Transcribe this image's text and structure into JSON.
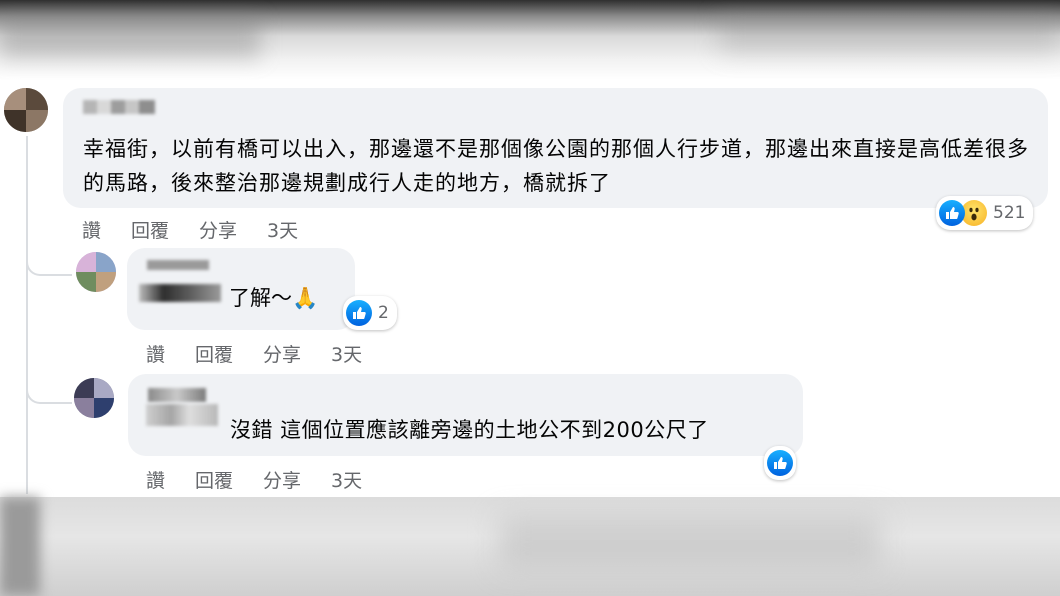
{
  "comments": {
    "main": {
      "text": "幸福街，以前有橋可以出入，那邊還不是那個像公園的那個人行步道，那邊出來直接是高低差很多的馬路，後來整治那邊規劃成行人走的地方，橋就拆了",
      "reaction_count": "521",
      "reaction_icons": [
        "like-icon",
        "wow-icon"
      ],
      "actions": {
        "like": "讚",
        "reply": "回覆",
        "share": "分享",
        "time": "3天"
      }
    },
    "reply1": {
      "text": "了解～🙏",
      "reaction_count": "2",
      "reaction_icons": [
        "like-icon"
      ],
      "actions": {
        "like": "讚",
        "reply": "回覆",
        "share": "分享",
        "time": "3天"
      }
    },
    "reply2": {
      "text": "沒錯 這個位置應該離旁邊的土地公不到200公尺了",
      "reaction_icons": [
        "like-icon"
      ],
      "actions": {
        "like": "讚",
        "reply": "回覆",
        "share": "分享",
        "time": "3天"
      }
    }
  },
  "colors": {
    "bubble": "#f0f2f5",
    "text": "#050505",
    "secondary": "#65676b",
    "like": "#0866ff",
    "wow": "#f7b125"
  }
}
